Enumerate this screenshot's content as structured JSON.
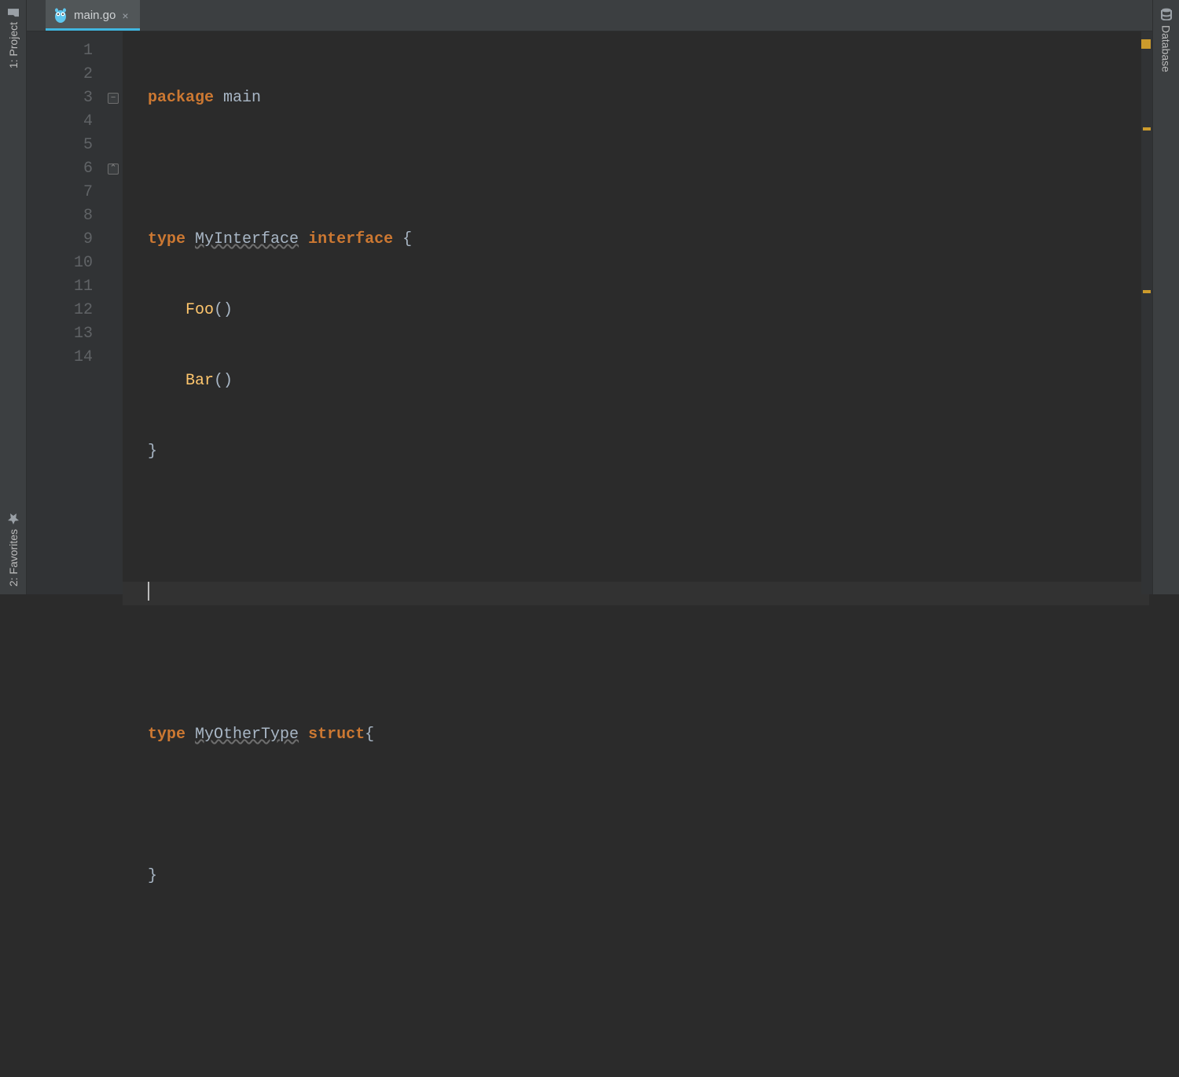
{
  "left_stripe": {
    "project": {
      "label": "1: Project"
    },
    "favorites": {
      "label": "2: Favorites"
    }
  },
  "right_stripe": {
    "database": {
      "label": "Database"
    }
  },
  "tabs": {
    "active": {
      "filename": "main.go",
      "close_glyph": "×"
    }
  },
  "editor": {
    "line_count": 14,
    "current_line": 8,
    "lines": {
      "l1": {
        "kw_package": "package",
        "pkg_name": "main"
      },
      "l2": "",
      "l3": {
        "kw_type": "type",
        "name": "MyInterface",
        "kw_kind": "interface",
        "brace": " {"
      },
      "l4": {
        "indent": "    ",
        "fn": "Foo",
        "paren": "()"
      },
      "l5": {
        "indent": "    ",
        "fn": "Bar",
        "paren": "()"
      },
      "l6": {
        "brace": "}"
      },
      "l7": "",
      "l8": "",
      "l9": "",
      "l10": {
        "kw_type": "type",
        "name": "MyOtherType",
        "kw_kind": "struct",
        "brace": "{"
      },
      "l11": "",
      "l12": {
        "brace": "}"
      },
      "l13": "",
      "l14": ""
    },
    "fold_marks": {
      "open_line": 3,
      "close_line": 6
    }
  },
  "markers": [
    {
      "pos_percent": 17,
      "type": "warn"
    },
    {
      "pos_percent": 46,
      "type": "warn"
    }
  ]
}
